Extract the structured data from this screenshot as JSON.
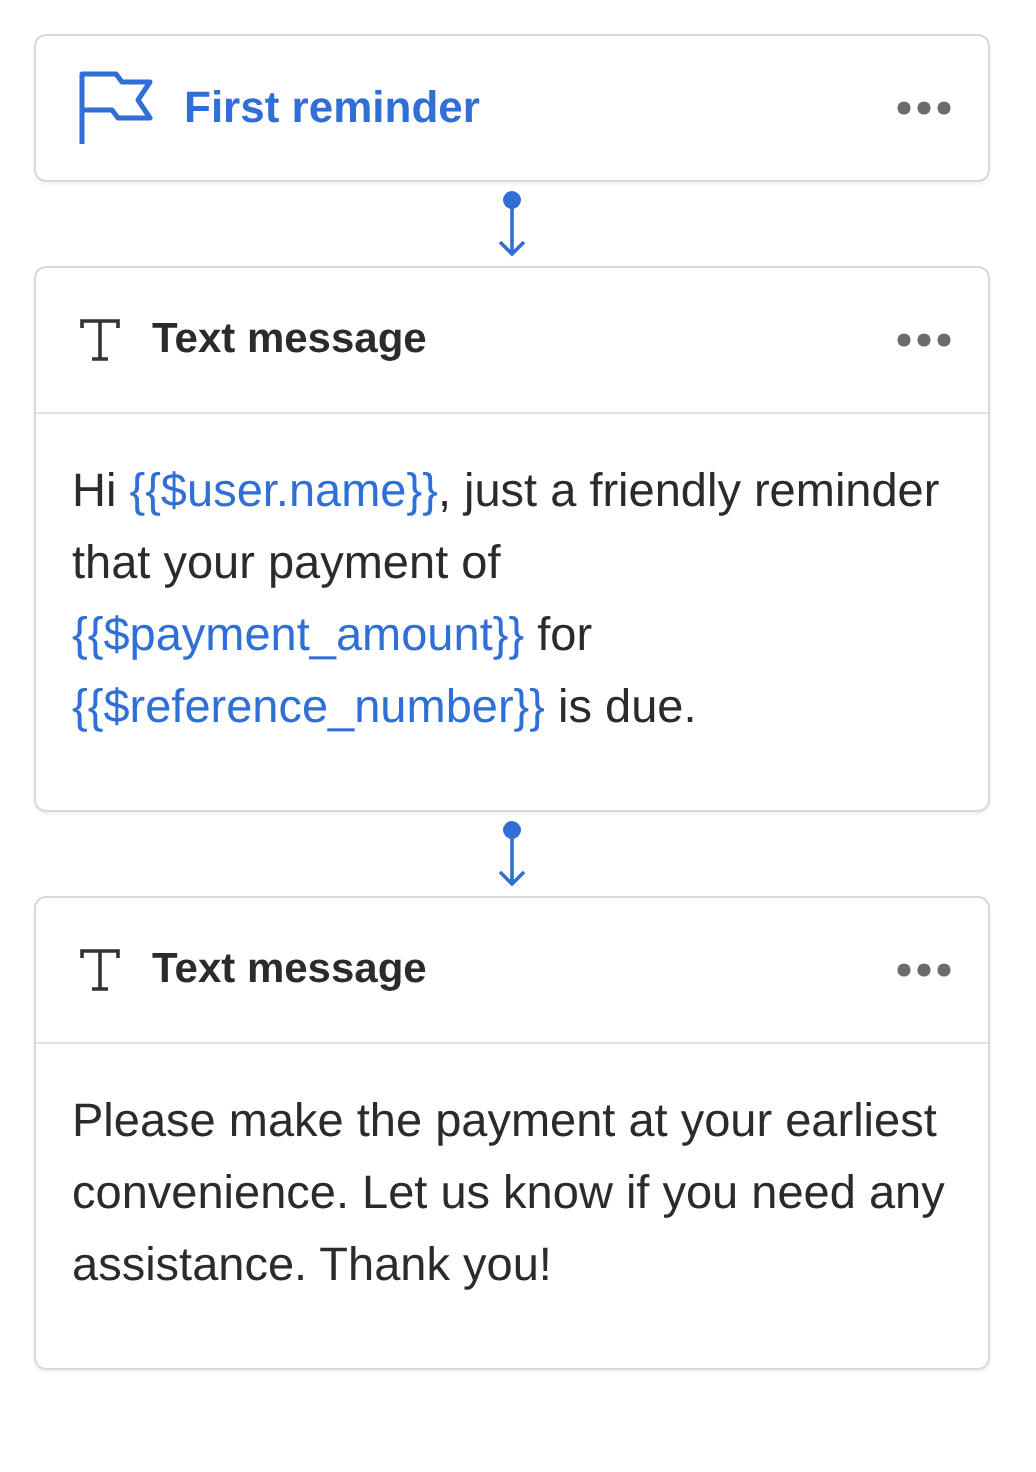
{
  "steps": [
    {
      "kind": "trigger",
      "title": "First reminder"
    },
    {
      "kind": "text_message",
      "title": "Text message",
      "body": [
        {
          "kind": "text",
          "text": "Hi "
        },
        {
          "kind": "variable",
          "text": "{{$user.name}}"
        },
        {
          "kind": "text",
          "text": ", just a friendly reminder that your payment of "
        },
        {
          "kind": "variable",
          "text": "{{$payment_amount}}"
        },
        {
          "kind": "text",
          "text": " for "
        },
        {
          "kind": "variable",
          "text": "{{$reference_number}}"
        },
        {
          "kind": "text",
          "text": " is due."
        }
      ]
    },
    {
      "kind": "text_message",
      "title": "Text message",
      "body": [
        {
          "kind": "text",
          "text": "Please make the payment at your earliest convenience. Let us know if you need any assistance. Thank you!"
        }
      ]
    }
  ]
}
